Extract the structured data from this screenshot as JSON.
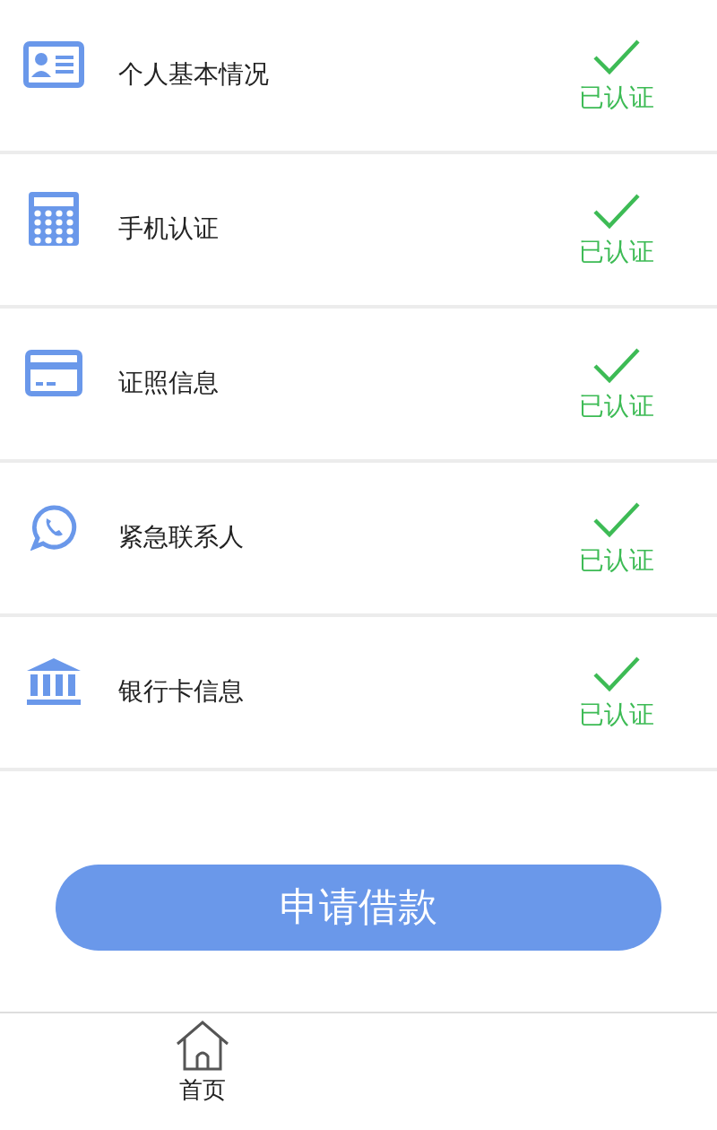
{
  "items": [
    {
      "kind": "id-card",
      "label": "个人基本情况",
      "status": "已认证",
      "verified": true
    },
    {
      "kind": "calculator",
      "label": "手机认证",
      "status": "已认证",
      "verified": true
    },
    {
      "kind": "card",
      "label": "证照信息",
      "status": "已认证",
      "verified": true
    },
    {
      "kind": "chat-phone",
      "label": "紧急联系人",
      "status": "已认证",
      "verified": true
    },
    {
      "kind": "bank",
      "label": "银行卡信息",
      "status": "已认证",
      "verified": true
    }
  ],
  "apply_button": "申请借款",
  "tab_bar": [
    {
      "label": "首页",
      "selected": true
    }
  ]
}
